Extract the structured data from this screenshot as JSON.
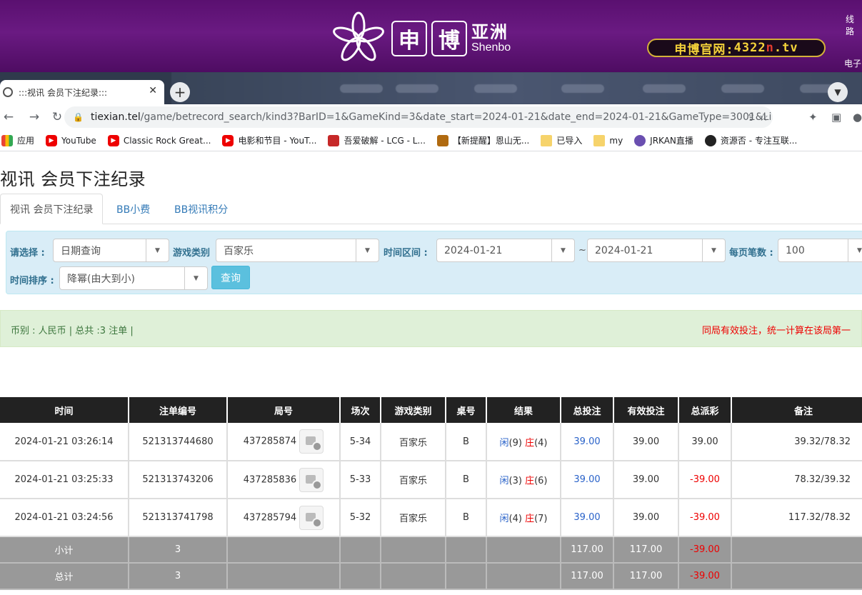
{
  "banner": {
    "logo_char1": "申",
    "logo_char2": "博",
    "logo_cn": "亚洲",
    "logo_en": "Shenbo",
    "site_prefix": "申博官网:",
    "site_num": "4322",
    "site_n": "n",
    "site_suffix": ".tv",
    "right_top": "线路",
    "right_bottom": "电子",
    "colors": {
      "bg": "#5a1070",
      "pill_text": "#f5d33a",
      "pill_border": "#d4b13a"
    }
  },
  "browser": {
    "tab_title": ":::视讯 会员下注纪录:::",
    "new_tab": "+",
    "url_host": "tiexian.tel",
    "url_path": "/game/betrecord_search/kind3?BarID=1&GameKind=3&date_start=2024-01-21&date_end=2024-01-21&GameType=3001&Li..."
  },
  "bookmarks": [
    {
      "label": "应用",
      "icon": "apps-icon"
    },
    {
      "label": "YouTube",
      "icon": "youtube-icon"
    },
    {
      "label": "Classic Rock Great...",
      "icon": "youtube-icon"
    },
    {
      "label": "电影和节目 - YouT...",
      "icon": "youtube-icon"
    },
    {
      "label": "吾爱破解 - LCG - L...",
      "icon": "site-icon"
    },
    {
      "label": "【新提醒】恩山无...",
      "icon": "site-icon"
    },
    {
      "label": "已导入",
      "icon": "folder-icon"
    },
    {
      "label": "my",
      "icon": "folder-icon"
    },
    {
      "label": "JRKAN直播",
      "icon": "site-icon"
    },
    {
      "label": "资源否 - 专注互联...",
      "icon": "site-icon"
    }
  ],
  "page": {
    "title": "视讯 会员下注纪录",
    "tabs": [
      "视讯 会员下注纪录",
      "BB小费",
      "BB视讯积分"
    ]
  },
  "filter": {
    "choose_label": "请选择 :",
    "choose_value": "日期查询",
    "game_type_label": "游戏类别",
    "game_type_value": "百家乐",
    "date_range_label": "时间区间 :",
    "date_start": "2024-01-21",
    "tilde": "~",
    "date_end": "2024-01-21",
    "per_page_label": "每页笔数 :",
    "per_page_value": "100",
    "sort_label": "时间排序 :",
    "sort_value": "降幂(由大到小)",
    "query_button": "查询"
  },
  "summary": {
    "left": "币别 : 人民币 | 总共 :3 注单 |",
    "right": "同局有效投注，统一计算在该局第一"
  },
  "table": {
    "headers": [
      "时间",
      "注单编号",
      "局号",
      "场次",
      "游戏类别",
      "桌号",
      "结果",
      "总投注",
      "有效投注",
      "总派彩",
      "备注"
    ],
    "rows": [
      {
        "time": "2024-01-21 03:26:14",
        "order": "521313744680",
        "round": "437285874",
        "session": "5-34",
        "game": "百家乐",
        "table": "B",
        "r_x": "闲",
        "r_xn": "(9)",
        "r_z": "庄",
        "r_zn": "(4)",
        "bet": "39.00",
        "valid": "39.00",
        "payout": "39.00",
        "payout_neg": false,
        "remark": "39.32/78.32"
      },
      {
        "time": "2024-01-21 03:25:33",
        "order": "521313743206",
        "round": "437285836",
        "session": "5-33",
        "game": "百家乐",
        "table": "B",
        "r_x": "闲",
        "r_xn": "(3)",
        "r_z": "庄",
        "r_zn": "(6)",
        "bet": "39.00",
        "valid": "39.00",
        "payout": "-39.00",
        "payout_neg": true,
        "remark": "78.32/39.32"
      },
      {
        "time": "2024-01-21 03:24:56",
        "order": "521313741798",
        "round": "437285794",
        "session": "5-32",
        "game": "百家乐",
        "table": "B",
        "r_x": "闲",
        "r_xn": "(4)",
        "r_z": "庄",
        "r_zn": "(7)",
        "bet": "39.00",
        "valid": "39.00",
        "payout": "-39.00",
        "payout_neg": true,
        "remark": "117.32/78.32"
      }
    ],
    "subtotal": {
      "label": "小计",
      "count": "3",
      "bet": "117.00",
      "valid": "117.00",
      "payout": "-39.00"
    },
    "total": {
      "label": "总计",
      "count": "3",
      "bet": "117.00",
      "valid": "117.00",
      "payout": "-39.00"
    }
  }
}
